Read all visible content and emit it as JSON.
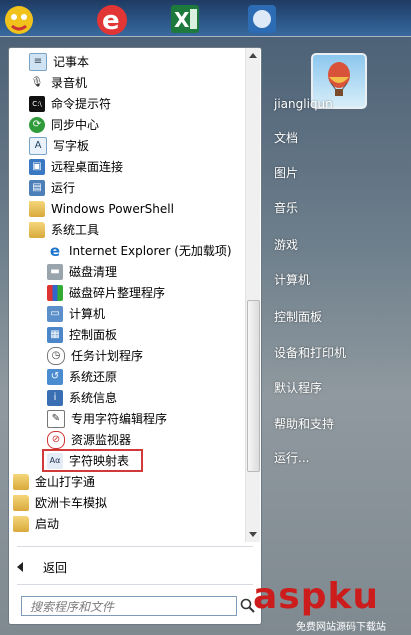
{
  "menu_items": [
    {
      "label": "记事本"
    },
    {
      "label": "录音机"
    },
    {
      "label": "命令提示符"
    },
    {
      "label": "同步中心"
    },
    {
      "label": "写字板"
    },
    {
      "label": "远程桌面连接"
    },
    {
      "label": "运行"
    },
    {
      "label": "Windows PowerShell"
    },
    {
      "label": "系统工具"
    },
    {
      "label": "Internet Explorer (无加载项)"
    },
    {
      "label": "磁盘清理"
    },
    {
      "label": "磁盘碎片整理程序"
    },
    {
      "label": "计算机"
    },
    {
      "label": "控制面板"
    },
    {
      "label": "任务计划程序"
    },
    {
      "label": "系统还原"
    },
    {
      "label": "系统信息"
    },
    {
      "label": "专用字符编辑程序"
    },
    {
      "label": "资源监视器"
    },
    {
      "label": "字符映射表"
    },
    {
      "label": "金山打字通"
    },
    {
      "label": "欧洲卡车模拟"
    },
    {
      "label": "启动"
    }
  ],
  "back_label": "返回",
  "search_placeholder": "搜索程序和文件",
  "right_items": [
    {
      "label": "jiangliqun"
    },
    {
      "label": "文档"
    },
    {
      "label": "图片"
    },
    {
      "label": "音乐"
    },
    {
      "label": "游戏"
    },
    {
      "label": "计算机"
    },
    {
      "label": "控制面板"
    },
    {
      "label": "设备和打印机"
    },
    {
      "label": "默认程序"
    },
    {
      "label": "帮助和支持"
    },
    {
      "label": "运行..."
    }
  ],
  "watermark": {
    "brand": "aspku",
    "sub": "免费网站源码下载站"
  },
  "colors": {
    "highlight": "#d23a3a"
  }
}
